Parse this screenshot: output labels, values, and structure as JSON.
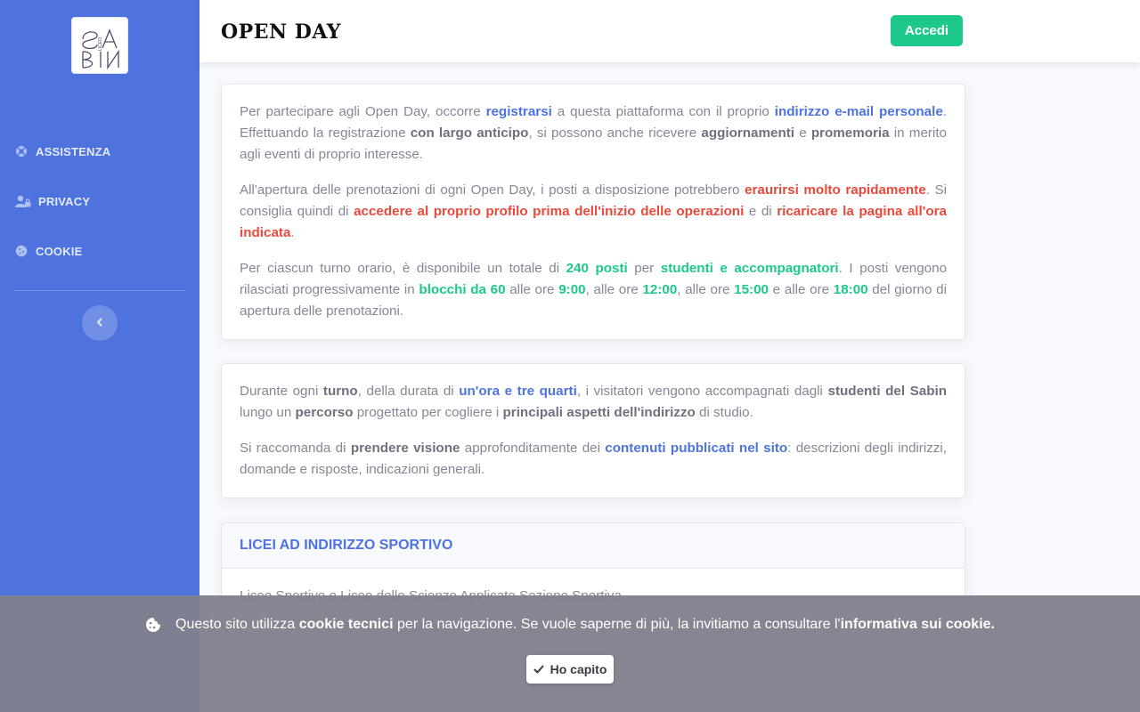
{
  "sidebar": {
    "logo_text": "LICEO SABIN",
    "items": [
      {
        "label": "ASSISTENZA",
        "icon": "life-ring-icon"
      },
      {
        "label": "PRIVACY",
        "icon": "user-lock-icon"
      },
      {
        "label": "COOKIE",
        "icon": "cookie-icon"
      }
    ],
    "toggle_icon": "chevron-left-icon"
  },
  "topbar": {
    "title": "OPEN DAY",
    "login_label": "Accedi"
  },
  "card1": {
    "p1": {
      "t1": "Per partecipare agli Open Day, occorre ",
      "b1": "registrarsi",
      "t2": " a questa piattaforma con il proprio ",
      "b2": "indirizzo e-mail personale",
      "t3": ". Effettuando la registrazione ",
      "b3": "con largo anticipo",
      "t4": ", si possono anche ricevere ",
      "b4": "aggiornamenti",
      "t5": " e ",
      "b5": "promemoria",
      "t6": " in merito agli eventi di proprio interesse."
    },
    "p2": {
      "t1": "All'apertura delle prenotazioni di ogni Open Day, i posti a disposizione potrebbero ",
      "b1": "eraurirsi molto rapidamente",
      "t2": ". Si consiglia quindi di ",
      "b2": "accedere al proprio profilo prima dell'inizio delle operazioni",
      "t3": " e di ",
      "b3": "ricaricare la pagina all'ora indicata",
      "t4": "."
    },
    "p3": {
      "t1": "Per ciascun turno orario, è disponibile un totale di ",
      "b1": "240 posti",
      "t2": " per ",
      "b2": "studenti e accompagnatori",
      "t3": ". I posti vengono rilasciati progressivamente in ",
      "b3": "blocchi da 60",
      "t4": " alle ore ",
      "b4": "9:00",
      "t5": ", alle ore ",
      "b5": "12:00",
      "t6": ", alle ore ",
      "b6": "15:00",
      "t7": " e alle ore ",
      "b7": "18:00",
      "t8": " del giorno di apertura delle prenotazioni."
    }
  },
  "card2": {
    "p1": {
      "t1": "Durante ogni ",
      "b1": "turno",
      "t2": ", della durata di ",
      "b2": "un'ora e tre quarti",
      "t3": ", i visitatori vengono accompagnati dagli ",
      "b3": "studenti del Sabin",
      "t4": " lungo un ",
      "b4": "percorso",
      "t5": " progettato per cogliere i ",
      "b5": "principali aspetti dell'indirizzo",
      "t6": " di studio."
    },
    "p2": {
      "t1": "Si raccomanda di ",
      "b1": "prendere visione",
      "t2": " approfonditamente dei ",
      "b2": "contenuti pubblicati nel sito",
      "t3": ": descrizioni degli indirizzi, domande e risposte, indicazioni generali."
    }
  },
  "card3": {
    "header": "LICEI AD INDIRIZZO SPORTIVO",
    "body": "Liceo Sportivo e Liceo delle Scienze Applicate Sezione Sportiva"
  },
  "cookie_banner": {
    "t1": "Questo sito utilizza ",
    "b1": "cookie tecnici",
    "t2": " per la navigazione. Se vuole saperne di più, la invitiamo a consultare l'",
    "b2": "informativa sui cookie.",
    "button_label": "Ho capito",
    "icon": "cookie-icon"
  },
  "colors": {
    "sidebar": "#4e73df",
    "accent_green": "#1cc88a",
    "accent_red": "#e74a3b"
  }
}
